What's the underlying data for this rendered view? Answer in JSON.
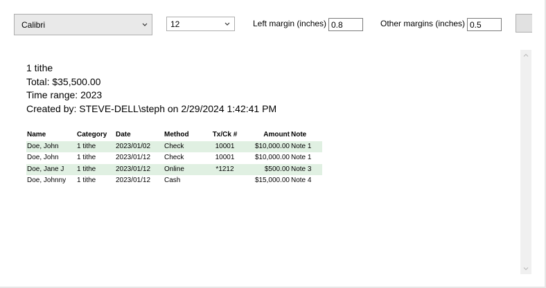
{
  "toolbar": {
    "font_value": "Calibri",
    "size_value": "12",
    "left_margin_label": "Left margin (inches)",
    "left_margin_value": "0.8",
    "other_margins_label": "Other margins (inches)",
    "other_margins_value": "0.5"
  },
  "report": {
    "lines": [
      "1 tithe",
      "Total: $35,500.00",
      "Time range: 2023",
      "Created by: STEVE-DELL\\steph on 2/29/2024 1:42:41 PM"
    ],
    "columns": [
      "Name",
      "Category",
      "Date",
      "Method",
      "Tx/Ck #",
      "Amount",
      "Note"
    ],
    "rows": [
      [
        "Doe, John",
        "1 tithe",
        "2023/01/02",
        "Check",
        "10001",
        "$10,000.00",
        "Note 1"
      ],
      [
        "Doe, John",
        "1 tithe",
        "2023/01/12",
        "Check",
        "10001",
        "$10,000.00",
        "Note 1"
      ],
      [
        "Doe, Jane J",
        "1 tithe",
        "2023/01/12",
        "Online",
        "*1212",
        "$500.00",
        "Note 3"
      ],
      [
        "Doe, Johnny",
        "1 tithe",
        "2023/01/12",
        "Cash",
        "",
        "$15,000.00",
        "Note 4"
      ]
    ],
    "band_color": "#e0f0e2"
  }
}
